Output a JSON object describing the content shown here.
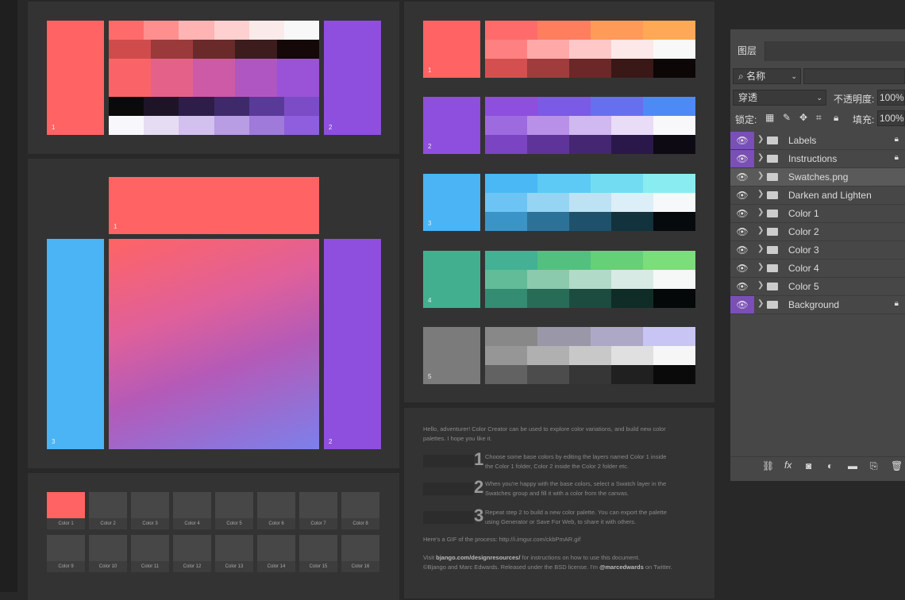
{
  "canvas": {
    "panel_a": {
      "labels": [
        "1",
        "2"
      ],
      "colors": {
        "left": "#ff6363",
        "right": "#8e4ede"
      },
      "strips": [
        [
          "#ff6b6b",
          "#ff8f8f",
          "#ffb3b3",
          "#ffd0d0",
          "#fbeaea",
          "#f8f8f8"
        ],
        [
          "#d04c4c",
          "#9a3a3a",
          "#6a2a2a",
          "#3c1c1c",
          "#140808"
        ],
        [
          "#fa6468",
          "#e4628a",
          "#cc5aa6",
          "#b056c2",
          "#9a52d6"
        ],
        [
          "#0a0a0a",
          "#1e1428",
          "#2c1e48",
          "#3e2a6a",
          "#5a3a98",
          "#7c4cc6"
        ],
        [
          "#f8f8fc",
          "#e6dcf4",
          "#d2c0ee",
          "#b89ce4",
          "#a07ada",
          "#8e5ede"
        ]
      ]
    },
    "panel_b": {
      "labels": [
        "1",
        "3",
        "2"
      ],
      "colors": {
        "top": "#ff6363",
        "left": "#4ab4f4",
        "right": "#8e4ede",
        "grad_top": "#ff6464",
        "grad_bottom": "#7c80ea"
      }
    },
    "swatches": [
      {
        "label": "Color 1",
        "color": "#ff6363"
      },
      {
        "label": "Color 2"
      },
      {
        "label": "Color 3"
      },
      {
        "label": "Color 4"
      },
      {
        "label": "Color 5"
      },
      {
        "label": "Color 6"
      },
      {
        "label": "Color 7"
      },
      {
        "label": "Color 8"
      },
      {
        "label": "Color 9"
      },
      {
        "label": "Color 10"
      },
      {
        "label": "Color 11"
      },
      {
        "label": "Color 12"
      },
      {
        "label": "Color 13"
      },
      {
        "label": "Color 14"
      },
      {
        "label": "Color 15"
      },
      {
        "label": "Color 16"
      }
    ],
    "color_groups": [
      {
        "label": "1",
        "color": "#ff6363",
        "strips": [
          [
            "#ff6b6b",
            "#ff7e5e",
            "#ff9a58",
            "#ffa856"
          ],
          [
            "#ff8080",
            "#ffa8a8",
            "#ffc8c8",
            "#fce8e8",
            "#f8f8f8"
          ],
          [
            "#d45050",
            "#a03c3c",
            "#6c2828",
            "#3a1818",
            "#0c0606"
          ]
        ]
      },
      {
        "label": "2",
        "color": "#8e4ede",
        "strips": [
          [
            "#8e4ede",
            "#7a5ae6",
            "#6670ee",
            "#4e8af6"
          ],
          [
            "#9e6ae0",
            "#b890e8",
            "#d0b8f0",
            "#e8dcf6",
            "#f8f8fa"
          ],
          [
            "#7a44c2",
            "#5e349a",
            "#442672",
            "#2a184a",
            "#0e0a14"
          ]
        ]
      },
      {
        "label": "3",
        "color": "#4ab4f4",
        "strips": [
          [
            "#4ab8f4",
            "#5ccaf4",
            "#72dcf2",
            "#88ecf0"
          ],
          [
            "#6cc4f4",
            "#96d4f4",
            "#bce2f4",
            "#dceef8",
            "#f6f8fa"
          ],
          [
            "#3a94c8",
            "#2c7298",
            "#1e526c",
            "#12323e",
            "#060a0c"
          ]
        ]
      },
      {
        "label": "4",
        "color": "#42b08e",
        "strips": [
          [
            "#44b094",
            "#54c080",
            "#66d078",
            "#7ade7a"
          ],
          [
            "#62bc98",
            "#8ccaae",
            "#b2dac8",
            "#d8eae4",
            "#f6f8f8"
          ],
          [
            "#348c72",
            "#286c58",
            "#1c4c40",
            "#102c26",
            "#040808"
          ]
        ]
      },
      {
        "label": "5",
        "color": "#7b7b7b",
        "strips": [
          [
            "#888888",
            "#9a98a8",
            "#aca8c6",
            "#c8c4f4"
          ],
          [
            "#969696",
            "#b0b0b0",
            "#c8c8c8",
            "#e0e0e0",
            "#f6f6f6"
          ],
          [
            "#626262",
            "#4c4c4c",
            "#363636",
            "#202020",
            "#0a0a0a"
          ]
        ]
      }
    ],
    "instructions": {
      "intro": "Hello, adventurer! Color Creator can be used to explore color variations, and build new color palettes. I hope you like it.",
      "steps": [
        {
          "num": "1",
          "text": "Choose some base colors by editing the layers named Color 1 inside the Color 1 folder, Color 2 inside the Color 2 folder etc."
        },
        {
          "num": "2",
          "text": "When you're happy with the base colors, select a Swatch layer in the Swatches group and fill it with a color from the canvas."
        },
        {
          "num": "3",
          "text": "Repeat step 2 to build a new color palette. You can export the palette using Generator or Save For Web, to share it with others."
        }
      ],
      "gif": "Here's a GIF of the process: http://i.imgur.com/ckbPmAR.gif",
      "visit_pre": "Visit ",
      "visit_link": "bjango.com/designresources/",
      "visit_post": " for instructions on how to use this document.",
      "credit_pre": "©Bjango and Marc Edwards. Released under the BSD license. I'm ",
      "credit_handle": "@marcedwards",
      "credit_post": " on Twitter."
    }
  },
  "layers_panel": {
    "tab": "图层",
    "filter": "名称",
    "blend_mode": "穿透",
    "opacity_label": "不透明度:",
    "opacity": "100%",
    "lock_label": "锁定:",
    "fill_label": "填充:",
    "fill": "100%",
    "accent": "#7a4fb8",
    "layers": [
      {
        "name": "Labels",
        "locked": true,
        "accent": true
      },
      {
        "name": "Instructions",
        "locked": true,
        "accent": true
      },
      {
        "name": "Swatches.png",
        "selected": true
      },
      {
        "name": "Darken and Lighten"
      },
      {
        "name": "Color 1"
      },
      {
        "name": "Color 2"
      },
      {
        "name": "Color 3"
      },
      {
        "name": "Color 4"
      },
      {
        "name": "Color 5"
      },
      {
        "name": "Background",
        "locked": true,
        "accent": true
      }
    ]
  }
}
